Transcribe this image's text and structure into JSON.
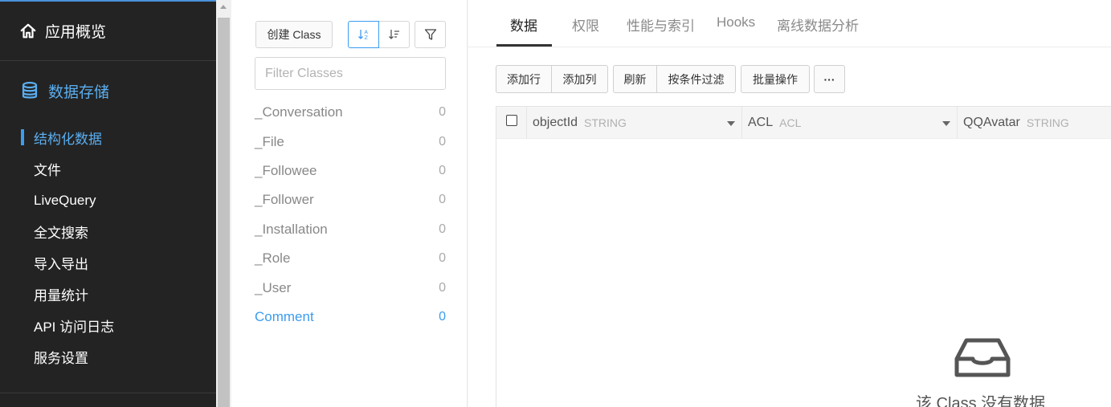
{
  "sidebar": {
    "app_title": "应用概览",
    "section_title": "数据存储",
    "items": [
      {
        "label": "结构化数据",
        "active": true
      },
      {
        "label": "文件"
      },
      {
        "label": "LiveQuery"
      },
      {
        "label": "全文搜索"
      },
      {
        "label": "导入导出"
      },
      {
        "label": "用量统计"
      },
      {
        "label": "API 访问日志"
      },
      {
        "label": "服务设置"
      }
    ]
  },
  "class_panel": {
    "create_label": "创建 Class",
    "filter_placeholder": "Filter Classes",
    "classes": [
      {
        "name": "_Conversation",
        "count": "0"
      },
      {
        "name": "_File",
        "count": "0"
      },
      {
        "name": "_Followee",
        "count": "0"
      },
      {
        "name": "_Follower",
        "count": "0"
      },
      {
        "name": "_Installation",
        "count": "0"
      },
      {
        "name": "_Role",
        "count": "0"
      },
      {
        "name": "_User",
        "count": "0"
      },
      {
        "name": "Comment",
        "count": "0",
        "active": true
      }
    ]
  },
  "tabs": [
    {
      "label": "数据",
      "active": true
    },
    {
      "label": "权限"
    },
    {
      "label": "性能与索引"
    },
    {
      "label": "Hooks"
    },
    {
      "label": "离线数据分析"
    }
  ],
  "toolbar": {
    "add_row": "添加行",
    "add_column": "添加列",
    "refresh": "刷新",
    "filter": "按条件过滤",
    "batch": "批量操作",
    "more": "···"
  },
  "columns": [
    {
      "name": "objectId",
      "type": "STRING"
    },
    {
      "name": "ACL",
      "type": "ACL"
    },
    {
      "name": "QQAvatar",
      "type": "STRING"
    }
  ],
  "empty_text": "该 Class 没有数据",
  "colors": {
    "accent": "#3b9cf0",
    "sidebar_bg": "#232323"
  }
}
